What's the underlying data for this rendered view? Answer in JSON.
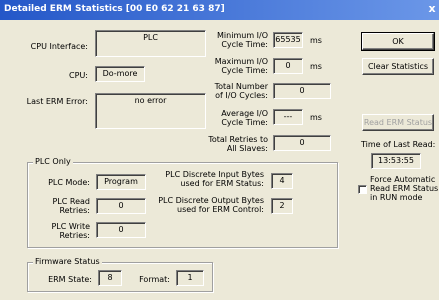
{
  "window": {
    "title": "Detailed ERM Statistics [00 E0 62 21 63 87]",
    "close_glyph": "x"
  },
  "labels": {
    "cpu_interface": "CPU Interface:",
    "cpu": "CPU:",
    "last_erm_error": "Last ERM Error:",
    "min_io_cycle_time_1": "Minimum I/O",
    "min_io_cycle_time_2": "Cycle Time:",
    "max_io_cycle_time_1": "Maximum I/O",
    "max_io_cycle_time_2": "Cycle Time:",
    "total_io_cycles_1": "Total Number",
    "total_io_cycles_2": "of I/O Cycles:",
    "avg_io_cycle_time_1": "Average I/O",
    "avg_io_cycle_time_2": "Cycle Time:",
    "total_retries_1": "Total Retries to",
    "total_retries_2": "All Slaves:",
    "ms": "ms",
    "time_of_last_read": "Time of Last Read:",
    "force_auto_1": "Force Automatic",
    "force_auto_2": "Read ERM Status",
    "force_auto_3": "in RUN mode"
  },
  "values": {
    "cpu_interface": "PLC",
    "cpu": "Do-more",
    "last_erm_error": "no error",
    "min_io_cycle_time": "65535",
    "max_io_cycle_time": "0",
    "total_io_cycles": "0",
    "avg_io_cycle_time": "---",
    "total_retries": "0",
    "time_of_last_read": "13:53:55"
  },
  "buttons": {
    "ok": "OK",
    "clear_statistics": "Clear Statistics",
    "read_erm_status": "Read ERM Status"
  },
  "plc_only": {
    "title": "PLC Only",
    "plc_mode_label": "PLC Mode:",
    "plc_mode_value": "Program",
    "plc_read_retries_1": "PLC Read",
    "plc_read_retries_2": "Retries:",
    "plc_read_retries_value": "0",
    "plc_write_retries_1": "PLC Write",
    "plc_write_retries_2": "Retries:",
    "plc_write_retries_value": "0",
    "discrete_input_1": "PLC Discrete Input Bytes",
    "discrete_input_2": "used for ERM Status:",
    "discrete_input_value": "4",
    "discrete_output_1": "PLC Discrete Output Bytes",
    "discrete_output_2": "used for ERM Control:",
    "discrete_output_value": "2"
  },
  "firmware": {
    "title": "Firmware Status",
    "erm_state_label": "ERM State:",
    "erm_state_value": "8",
    "format_label": "Format:",
    "format_value": "1"
  },
  "force_auto_checked": false
}
